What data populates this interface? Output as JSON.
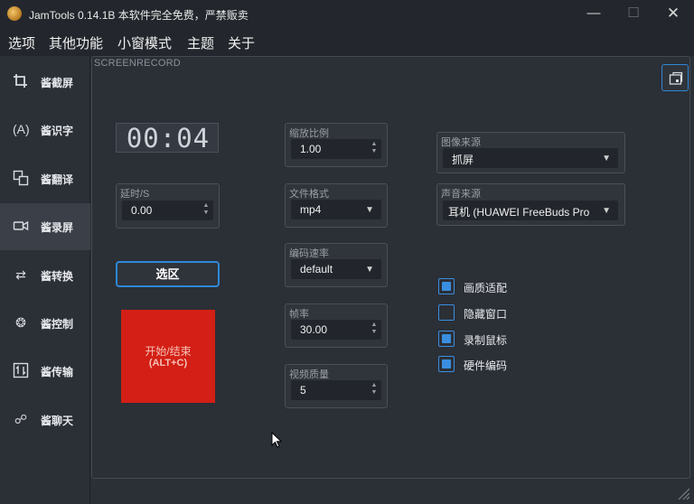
{
  "window": {
    "title": "JamTools 0.14.1B 本软件完全免费，严禁贩卖"
  },
  "menubar": [
    "选项",
    "其他功能",
    "小窗模式",
    "主题",
    "关于"
  ],
  "sidebar": {
    "items": [
      {
        "label": "酱截屏",
        "icon": "crop-icon"
      },
      {
        "label": "酱识字",
        "icon": "ocr-icon"
      },
      {
        "label": "酱翻译",
        "icon": "translate-icon"
      },
      {
        "label": "酱录屏",
        "icon": "video-icon",
        "active": true
      },
      {
        "label": "酱转换",
        "icon": "convert-icon"
      },
      {
        "label": "酱控制",
        "icon": "control-icon"
      },
      {
        "label": "酱传输",
        "icon": "transfer-icon"
      },
      {
        "label": "酱聊天",
        "icon": "chat-icon"
      }
    ]
  },
  "panel": {
    "title": "SCREENRECORD"
  },
  "timer": {
    "value": "00:04"
  },
  "delay": {
    "label": "延时/S",
    "value": "0.00"
  },
  "select_area": {
    "label": "选区"
  },
  "record": {
    "label": "开始/结束",
    "hotkey": "(ALT+C)",
    "color": "#d31f15"
  },
  "scale": {
    "label": "缩放比例",
    "value": "1.00"
  },
  "format": {
    "label": "文件格式",
    "value": "mp4"
  },
  "encoding": {
    "label": "编码速率",
    "value": "default"
  },
  "fps": {
    "label": "帧率",
    "value": "30.00"
  },
  "quality": {
    "label": "视频质量",
    "value": "5"
  },
  "image_source": {
    "label": "图像来源",
    "value": "抓屏"
  },
  "audio_source": {
    "label": "声音来源",
    "value": "耳机 (HUAWEI FreeBuds Pro"
  },
  "options": [
    {
      "label": "画质适配",
      "checked": true
    },
    {
      "label": "隐藏窗口",
      "checked": false
    },
    {
      "label": "录制鼠标",
      "checked": true
    },
    {
      "label": "硬件编码",
      "checked": true
    }
  ],
  "colors": {
    "accent": "#2f88d6",
    "background": "#2b2f36",
    "titlebar": "#23272d"
  }
}
